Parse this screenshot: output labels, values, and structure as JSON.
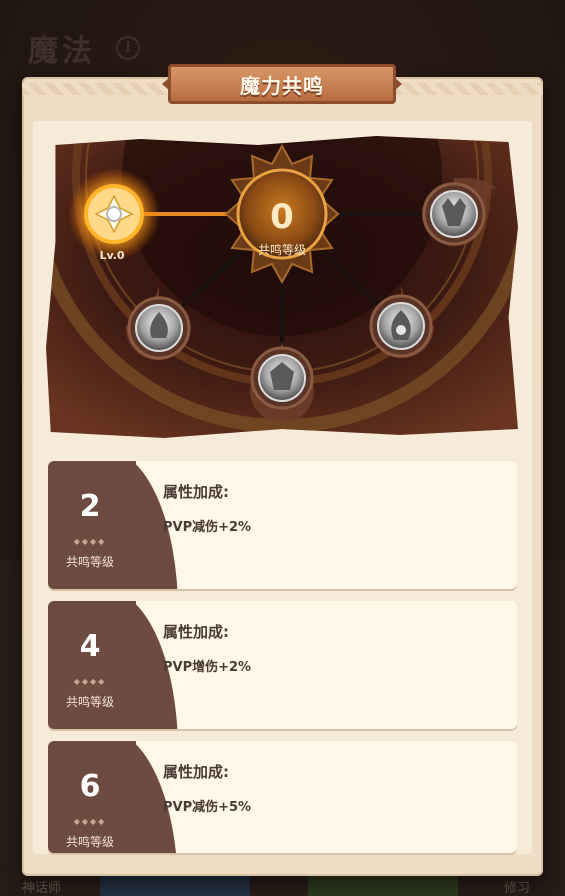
{
  "background": {
    "title": "魔法",
    "info_icon": "i",
    "bottom_labels": [
      "神话师",
      "修习"
    ]
  },
  "panel": {
    "title": "魔力共鸣"
  },
  "resonance": {
    "level_value": "0",
    "level_label": "共鸣等级",
    "node_level": "Lv.0",
    "nodes": [
      "light-element-node",
      "air-element-node",
      "earth-element-node",
      "fire-element-node",
      "water-element-node"
    ]
  },
  "bonus_list": [
    {
      "level": "2",
      "level_label": "共鸣等级",
      "heading": "属性加成:",
      "effect": "PVP减伤+2%"
    },
    {
      "level": "4",
      "level_label": "共鸣等级",
      "heading": "属性加成:",
      "effect": "PVP增伤+2%"
    },
    {
      "level": "6",
      "level_label": "共鸣等级",
      "heading": "属性加成:",
      "effect": "PVP减伤+5%"
    }
  ],
  "colors": {
    "panel": "#efdcc4",
    "card_left": "#6e4b40",
    "glow": "#f5a623",
    "title_banner": "#c47a4a"
  }
}
